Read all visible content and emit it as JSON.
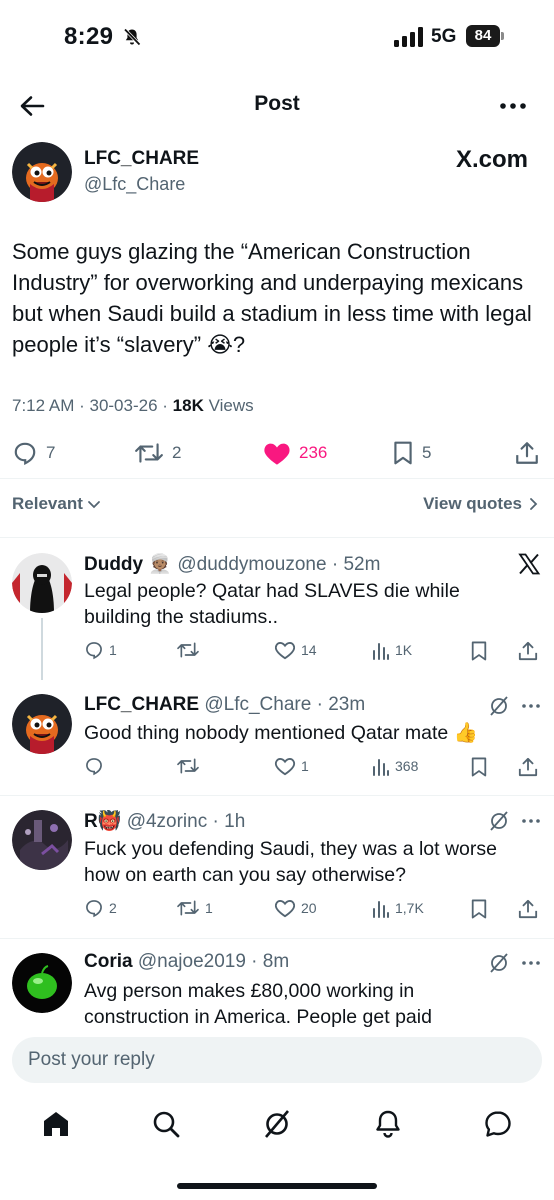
{
  "status_bar": {
    "time": "8:29",
    "network": "5G",
    "battery": "84"
  },
  "header": {
    "title": "Post"
  },
  "post": {
    "author_name": "LFC_CHARE",
    "author_handle": "@Lfc_Chare",
    "source_label": "X.com",
    "text": "Some guys glazing the “American Construction Industry” for overworking and underpaying mexicans but when Saudi build a stadium in less time with legal people it’s “slavery” 😭?",
    "time": "7:12 AM",
    "date": "30-03-26",
    "views_count": "18K",
    "views_label": "Views",
    "replies": "7",
    "reposts": "2",
    "likes": "236",
    "bookmarks": "5",
    "like_color": "#f91880"
  },
  "filters": {
    "sort_label": "Relevant",
    "view_quotes_label": "View quotes"
  },
  "replies": [
    {
      "name": "Duddy",
      "name_emoji": "👳🏽",
      "handle": "@duddymouzone",
      "time": "52m",
      "text": "Legal people? Qatar had SLAVES die while building the stadiums..",
      "replies": "1",
      "reposts": "",
      "likes": "14",
      "views": "1K"
    },
    {
      "name": "LFC_CHARE",
      "name_emoji": "",
      "handle": "@Lfc_Chare",
      "time": "23m",
      "text": "Good thing nobody mentioned Qatar mate 👍",
      "replies": "",
      "reposts": "",
      "likes": "1",
      "views": "368"
    },
    {
      "name": "R",
      "name_emoji": "👹",
      "handle": "@4zorinc",
      "time": "1h",
      "text": "Fuck you defending Saudi, they was a lot worse how on earth can you say otherwise?",
      "replies": "2",
      "reposts": "1",
      "likes": "20",
      "views": "1,7K"
    },
    {
      "name": "Coria",
      "name_emoji": "",
      "handle": "@najoe2019",
      "time": "8m",
      "text": "Avg person makes £80,000 working in construction in America.  People get paid"
    }
  ],
  "reply_box": {
    "placeholder": "Post your reply"
  },
  "colors": {
    "text_primary": "#0f1419",
    "text_secondary": "#536471",
    "like_pink": "#f91880",
    "divider": "#eff3f4"
  }
}
